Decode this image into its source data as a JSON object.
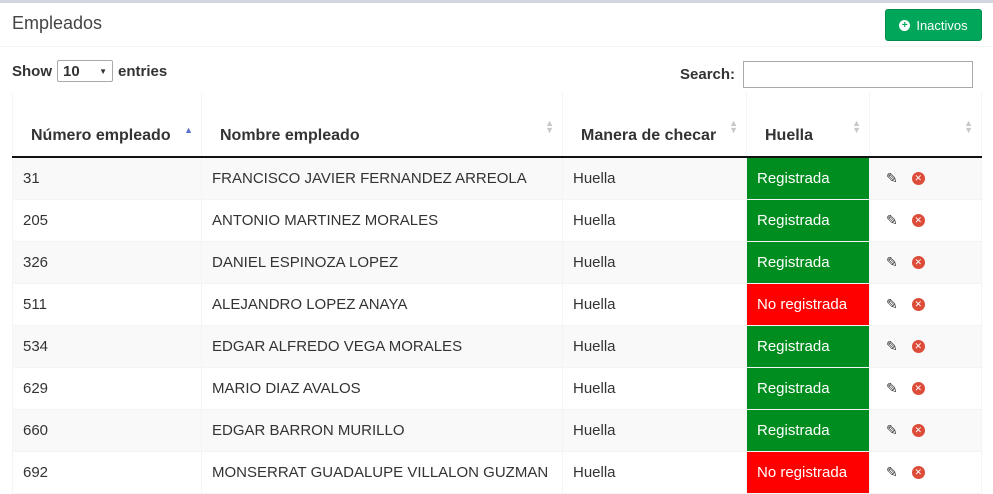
{
  "panel": {
    "title": "Empleados",
    "inactivos_button": "Inactivos"
  },
  "length": {
    "show_label": "Show",
    "value": "10",
    "entries_label": "entries"
  },
  "search": {
    "label": "Search:",
    "value": ""
  },
  "columns": [
    {
      "label": "Número empleado"
    },
    {
      "label": "Nombre empleado"
    },
    {
      "label": "Manera de checar"
    },
    {
      "label": "Huella"
    },
    {
      "label": ""
    }
  ],
  "rows": [
    {
      "numero": "31",
      "nombre": "FRANCISCO JAVIER FERNANDEZ ARREOLA",
      "manera": "Huella",
      "huella": "Registrada"
    },
    {
      "numero": "205",
      "nombre": "ANTONIO MARTINEZ MORALES",
      "manera": "Huella",
      "huella": "Registrada"
    },
    {
      "numero": "326",
      "nombre": "DANIEL ESPINOZA LOPEZ",
      "manera": "Huella",
      "huella": "Registrada"
    },
    {
      "numero": "511",
      "nombre": "ALEJANDRO LOPEZ ANAYA",
      "manera": "Huella",
      "huella": "No registrada"
    },
    {
      "numero": "534",
      "nombre": "EDGAR ALFREDO VEGA MORALES",
      "manera": "Huella",
      "huella": "Registrada"
    },
    {
      "numero": "629",
      "nombre": "MARIO DIAZ AVALOS",
      "manera": "Huella",
      "huella": "Registrada"
    },
    {
      "numero": "660",
      "nombre": "EDGAR BARRON MURILLO",
      "manera": "Huella",
      "huella": "Registrada"
    },
    {
      "numero": "692",
      "nombre": "MONSERRAT GUADALUPE VILLALON GUZMAN",
      "manera": "Huella",
      "huella": "No registrada"
    }
  ],
  "colors": {
    "registrada": "#008d1f",
    "no_registrada": "#ff0000",
    "button": "#00a65a"
  },
  "icons": {
    "edit": "pencil-icon",
    "delete": "times-circle-icon",
    "button": "plus-circle-icon"
  }
}
